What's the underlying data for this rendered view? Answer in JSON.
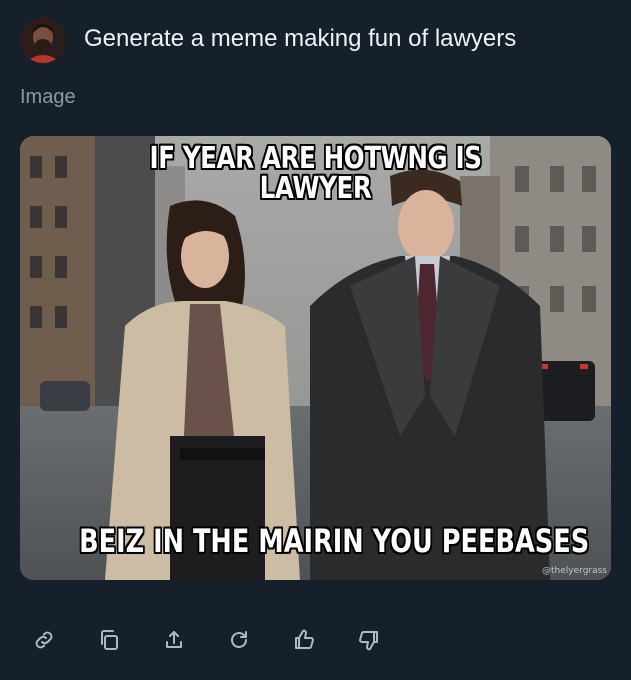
{
  "message": {
    "prompt": "Generate a meme making fun of lawyers"
  },
  "attachment": {
    "label": "Image",
    "meme_top_line1": "IF YEAR ARE HOTWNG IS",
    "meme_top_line2": "LAWYER",
    "meme_bottom": "BEIZ IN THE MAIRIN YOU PEEBASES",
    "watermark": "@thelyergrass"
  },
  "actions": [
    {
      "name": "copy-link",
      "icon": "link-icon"
    },
    {
      "name": "copy",
      "icon": "copy-icon"
    },
    {
      "name": "share",
      "icon": "share-icon"
    },
    {
      "name": "regenerate",
      "icon": "refresh-icon"
    },
    {
      "name": "like",
      "icon": "thumbs-up-icon"
    },
    {
      "name": "dislike",
      "icon": "thumbs-down-icon"
    }
  ],
  "colors": {
    "background": "#16202b",
    "text": "#eef2f6",
    "muted": "#8b98a5",
    "icon": "#aeb9c4"
  }
}
